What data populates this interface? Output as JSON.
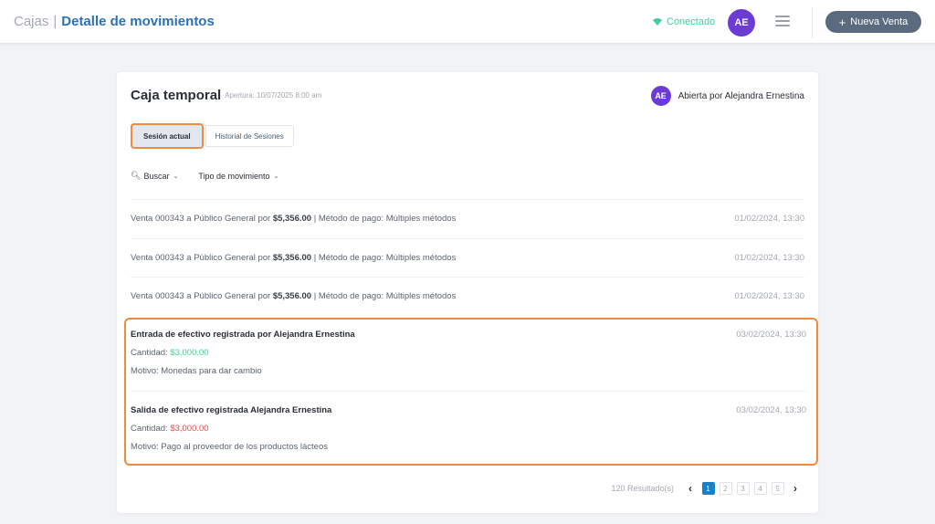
{
  "header": {
    "breadcrumb_root": "Cajas",
    "breadcrumb_sep": "|",
    "breadcrumb_current": "Detalle de movimientos",
    "status": "Conectado",
    "avatar_initials": "AE",
    "new_sale_label": "Nueva Venta"
  },
  "card": {
    "title": "Caja temporal",
    "subtitle": "Apertura: 10/07/2025 8:00 am",
    "opened_by_initials": "AE",
    "opened_by": "Abierta por Alejandra Ernestina"
  },
  "tabs": [
    {
      "label": "Sesión actual",
      "active": true
    },
    {
      "label": "Historial de Sesiones",
      "active": false
    }
  ],
  "filters": {
    "search_label": "Buscar",
    "type_label": "Tipo de movimiento"
  },
  "movements": [
    {
      "prefix": "Venta 000343 a Público General por ",
      "amount": "$5,356.00",
      "suffix": " | Método de pago: Múltiples métodos",
      "date": "01/02/2024, 13:30"
    },
    {
      "prefix": "Venta 000343 a Público General por ",
      "amount": "$5,356.00",
      "suffix": " | Método de pago: Múltiples métodos",
      "date": "01/02/2024, 13:30"
    },
    {
      "prefix": "Venta 000343 a Público General por ",
      "amount": "$5,356.00",
      "suffix": " | Método de pago: Múltiples métodos",
      "date": "01/02/2024, 13:30"
    }
  ],
  "cash_entries": [
    {
      "title": "Entrada de efectivo registrada por Alejandra Ernestina",
      "date": "03/02/2024, 13:30",
      "amount_label": "Cantidad: ",
      "amount": "$3,000.00",
      "reason": "Motivo: Monedas para dar cambio"
    },
    {
      "title": "Salida de efectivo registrada Alejandra Ernestina",
      "date": "03/02/2024, 13:30",
      "amount_label": "Cantidad: ",
      "amount": "$3,000.00",
      "reason": "Motivo: Pago al proveedor de los productos lácteos"
    }
  ],
  "pagination": {
    "results": "120 Resultado(s)",
    "pages": [
      "1",
      "2",
      "3",
      "4",
      "5"
    ],
    "current_page": "1"
  },
  "colors": {
    "accent": "#2c71b8",
    "status_green": "#3ecfa0",
    "avatar_purple": "#6b3bd4",
    "highlight_orange": "#f08a3c",
    "amount_in": "#3ecf8e",
    "amount_out": "#e84b4b",
    "pager_active": "#1d7fc4"
  }
}
